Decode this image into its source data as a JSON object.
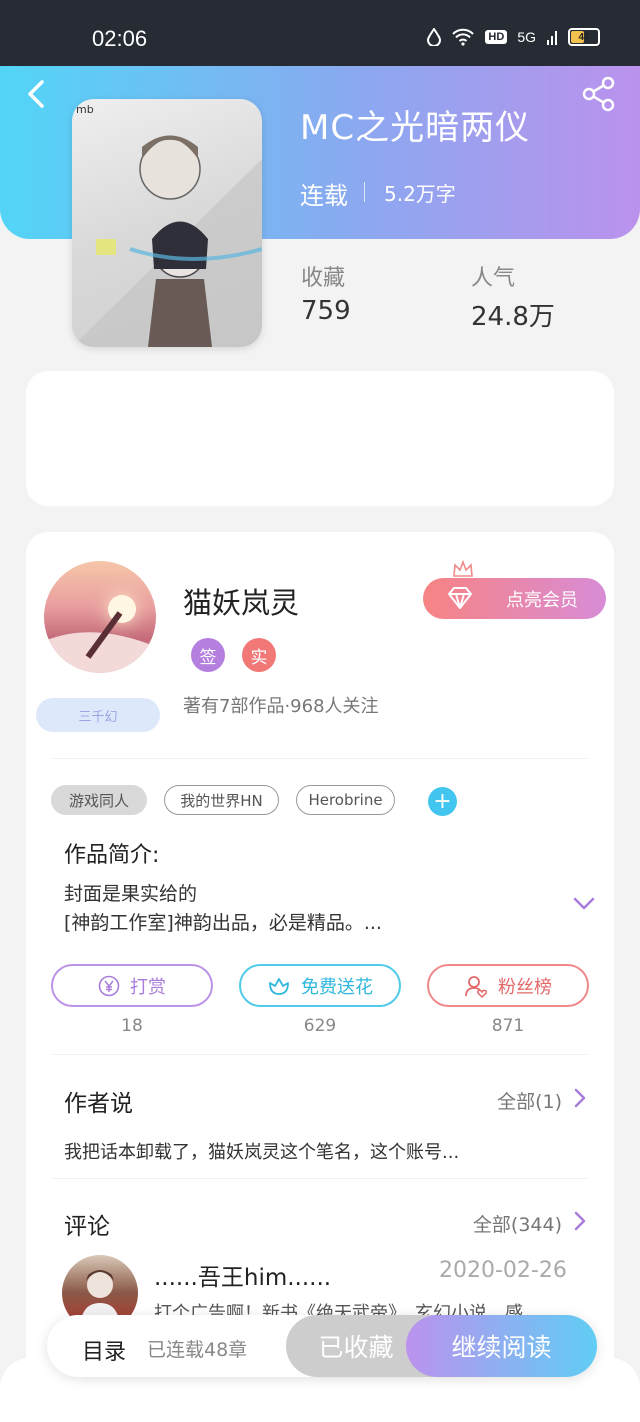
{
  "status_bar": {
    "time": "02:06",
    "hd": "HD",
    "network": "5G",
    "battery": "47"
  },
  "book": {
    "title": "MC之光暗两仪",
    "status": "连载",
    "words": "5.2万字",
    "cover_watermark": "mb",
    "stats": [
      {
        "label": "收藏",
        "value": "759"
      },
      {
        "label": "人气",
        "value": "24.8万"
      }
    ]
  },
  "author": {
    "name": "猫妖岚灵",
    "badge_sign": "签",
    "badge_real": "实",
    "stats": "著有7部作品·968人关注",
    "tag": "三千幻",
    "vip_label": "点亮会员"
  },
  "tags": [
    "游戏同人",
    "我的世界HN",
    "Herobrine"
  ],
  "tag_add": "+",
  "intro": {
    "title": "作品简介:",
    "line1": "封面是果实给的",
    "line2": "[神韵工作室]神韵出品，必是精品。..."
  },
  "actions": [
    {
      "label": "打赏",
      "count": "18",
      "icon": "yen-icon"
    },
    {
      "label": "免费送花",
      "count": "629",
      "icon": "flower-icon"
    },
    {
      "label": "粉丝榜",
      "count": "871",
      "icon": "fans-icon"
    }
  ],
  "author_says": {
    "title": "作者说",
    "more": "全部(1)",
    "text": "我把话本卸载了，猫妖岚灵这个笔名，这个账号..."
  },
  "comments": {
    "title": "评论",
    "more": "全部(344)",
    "first": {
      "user": "......吾王him......",
      "date": "2020-02-26",
      "text": "打个广告啊！新书《绝天武帝》，玄幻小说，感"
    }
  },
  "bottom": {
    "toc": "目录",
    "chapters": "已连载48章",
    "collected": "已收藏",
    "continue": "继续阅读"
  },
  "colors": {
    "accent_cyan": "#52d5f7",
    "accent_purple": "#bb92ed",
    "accent_red": "#f27878"
  }
}
